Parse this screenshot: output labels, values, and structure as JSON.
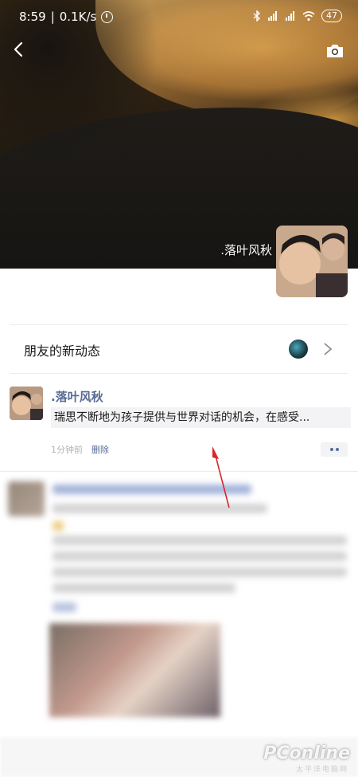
{
  "status_bar": {
    "time": "8:59",
    "speed": "0.1K/s",
    "battery": "47"
  },
  "cover": {
    "username": ".落叶风秋"
  },
  "friends": {
    "label": "朋友的新动态"
  },
  "post": {
    "name": ".落叶风秋",
    "text": "瑞思不断地为孩子提供与世界对话的机会，在感受...",
    "time": "1分钟前",
    "delete_label": "删除"
  },
  "watermark": {
    "brand": "PConline",
    "sub": "太平洋电脑网"
  },
  "colors": {
    "link": "#576b95",
    "arrow": "#d8262b"
  }
}
